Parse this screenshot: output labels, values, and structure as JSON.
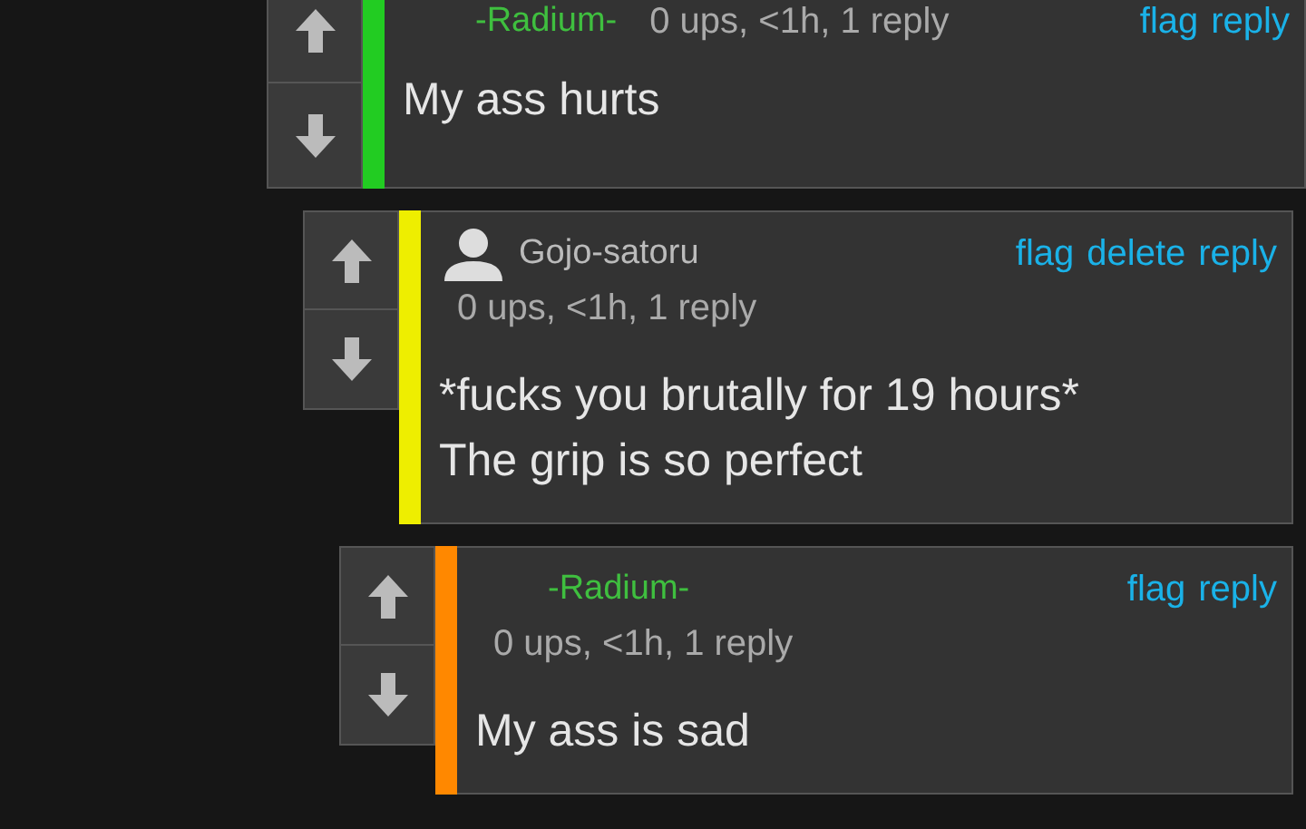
{
  "comments": [
    {
      "username": "-Radium-",
      "highlighted": true,
      "color": "#22cc22",
      "avatar": false,
      "kind": "inline",
      "meta": "0 ups, <1h, 1 reply",
      "actions": [
        "flag",
        "reply"
      ],
      "body": [
        "My ass hurts"
      ],
      "children": [
        {
          "username": "Gojo-satoru",
          "highlighted": false,
          "color": "#eeee00",
          "avatar": true,
          "kind": "stacked",
          "meta": "0 ups, <1h, 1 reply",
          "actions": [
            "flag",
            "delete",
            "reply"
          ],
          "body": [
            "*fucks you brutally for 19 hours*",
            "The grip is so perfect"
          ],
          "children": [
            {
              "username": "-Radium-",
              "highlighted": true,
              "color": "#ff8800",
              "avatar": false,
              "kind": "stacked",
              "meta": "0 ups, <1h, 1 reply",
              "actions": [
                "flag",
                "reply"
              ],
              "body": [
                "My ass is sad"
              ]
            }
          ]
        }
      ]
    }
  ]
}
